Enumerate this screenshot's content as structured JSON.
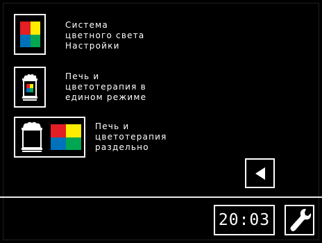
{
  "menu": {
    "item1_label": "Система\nцветного света\nНастройки",
    "item2_label": "Печь и\nцветотерапия в\nедином режиме",
    "item3_label": "Печь и\nцветотерапия\nраздельно"
  },
  "colors": {
    "red": "#e31e24",
    "yellow": "#ffed00",
    "blue": "#0072bc",
    "green": "#00a650"
  },
  "icons": {
    "color_grid": "color-grid-icon",
    "sauna_heater": "sauna-heater-icon",
    "back": "back-arrow-icon",
    "settings": "wrench-icon"
  },
  "status": {
    "time": "20:03"
  }
}
